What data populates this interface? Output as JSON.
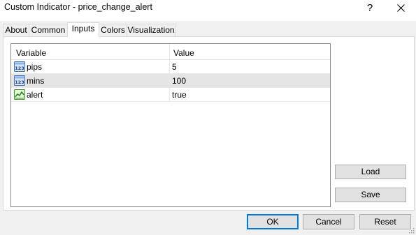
{
  "window": {
    "title": "Custom Indicator - price_change_alert",
    "help_glyph": "?",
    "close_icon": "close-icon"
  },
  "tabs": [
    {
      "label": "About",
      "active": false
    },
    {
      "label": "Common",
      "active": false
    },
    {
      "label": "Inputs",
      "active": true
    },
    {
      "label": "Colors",
      "active": false
    },
    {
      "label": "Visualization",
      "active": false
    }
  ],
  "grid": {
    "columns": [
      "Variable",
      "Value"
    ],
    "rows": [
      {
        "icon": "numeric-123-icon",
        "variable": "pips",
        "value": "5",
        "selected": false
      },
      {
        "icon": "numeric-123-icon",
        "variable": "mins",
        "value": "100",
        "selected": true
      },
      {
        "icon": "boolean-chart-icon",
        "variable": "alert",
        "value": "true",
        "selected": false
      }
    ]
  },
  "side_buttons": {
    "load": "Load",
    "save": "Save"
  },
  "dialog_buttons": {
    "ok": "OK",
    "cancel": "Cancel",
    "reset": "Reset"
  },
  "colors": {
    "accent": "#0078d7",
    "selection": "#e5e5e5",
    "panel": "#ffffff",
    "chrome": "#f0f0f0"
  }
}
